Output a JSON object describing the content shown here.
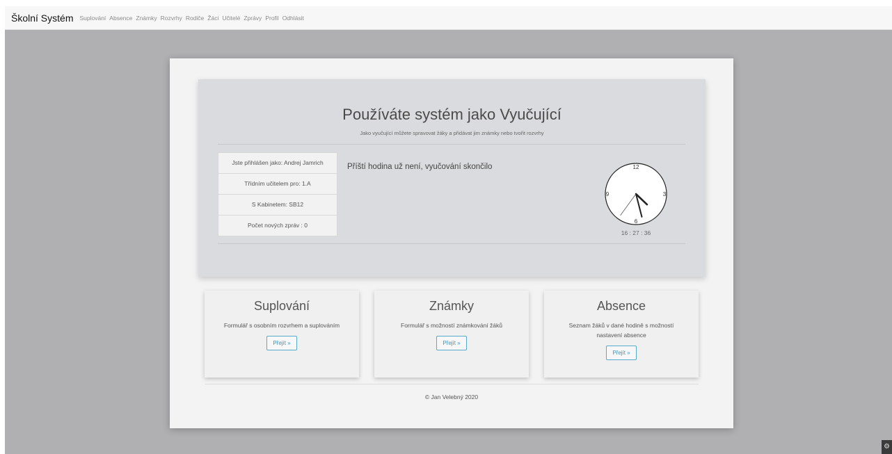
{
  "navbar": {
    "brand": "Školní Systém",
    "links": [
      "Suplování",
      "Absence",
      "Známky",
      "Rozvrhy",
      "Rodiče",
      "Žáci",
      "Učitelé",
      "Zprávy",
      "Profil",
      "Odhlásit"
    ]
  },
  "jumbotron": {
    "title": "Používáte systém jako Vyučující",
    "subtitle": "Jako vyučující můžete spravovat žáky a přidávat jim známky nebo tvořit rozvrhy",
    "info": [
      "Jste přihlášen jako: Andrej Jamrich",
      "Třídním učitelem pro: 1.A",
      "S Kabinetem: SB12",
      "Počet nových zpráv : 0"
    ],
    "next_lesson": "Příští hodina už není, vyučování skončilo",
    "clock": {
      "numbers": {
        "n12": "12",
        "n3": "3",
        "n6": "6",
        "n9": "9"
      },
      "time": "16 : 27 : 36",
      "hours": 16,
      "minutes": 27,
      "seconds": 36
    }
  },
  "features": [
    {
      "title": "Suplování",
      "description": "Formulář s osobním rozvrhem a suplováním",
      "button": "Přejít »"
    },
    {
      "title": "Známky",
      "description": "Formulář s možností známkování žáků",
      "button": "Přejít »"
    },
    {
      "title": "Absence",
      "description": "Seznam žáků v dané hodině s možností nastavení absence",
      "button": "Přejít »"
    }
  ],
  "footer": {
    "text": "© Jan Velebný 2020"
  },
  "corner_icon": "extension-icon"
}
